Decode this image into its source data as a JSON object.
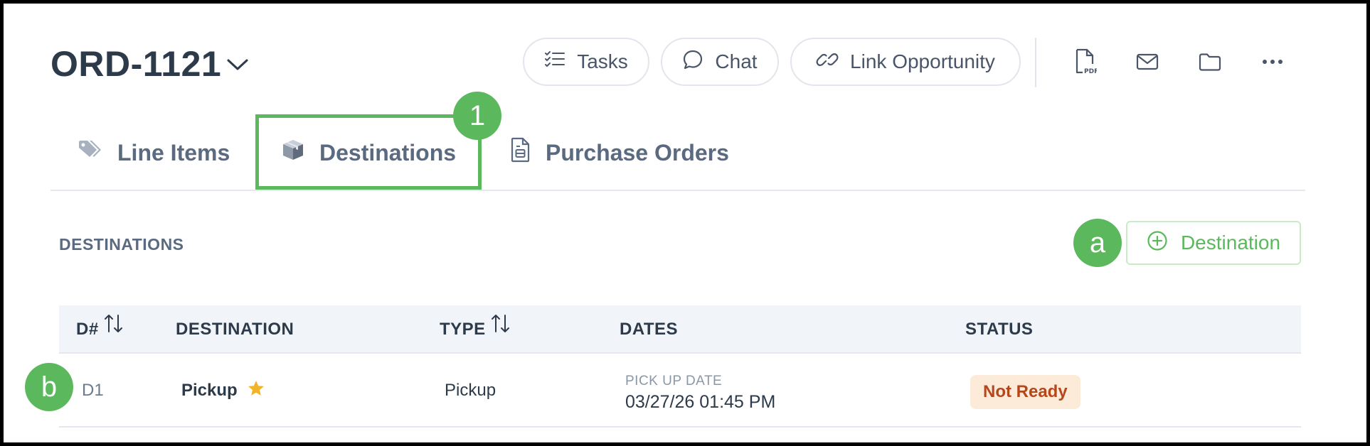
{
  "header": {
    "order_id": "ORD-1121",
    "buttons": {
      "tasks": "Tasks",
      "chat": "Chat",
      "link_opportunity": "Link Opportunity"
    },
    "icon_buttons": [
      "pdf-icon",
      "mail-icon",
      "folder-icon",
      "more-icon"
    ]
  },
  "tabs": [
    {
      "label": "Line Items",
      "icon": "tag-icon",
      "active": false
    },
    {
      "label": "Destinations",
      "icon": "box-icon",
      "active": true
    },
    {
      "label": "Purchase Orders",
      "icon": "document-icon",
      "active": false
    }
  ],
  "markers": {
    "tab": "1",
    "add_button": "a",
    "row": "b"
  },
  "section": {
    "title": "DESTINATIONS",
    "add_button_label": "Destination"
  },
  "table": {
    "columns": [
      "D#",
      "DESTINATION",
      "TYPE",
      "DATES",
      "STATUS"
    ],
    "rows": [
      {
        "id": "D1",
        "destination": "Pickup",
        "starred": true,
        "type": "Pickup",
        "date_label": "PICK UP DATE",
        "date_value": "03/27/26 01:45 PM",
        "status": "Not Ready"
      }
    ]
  },
  "colors": {
    "accent_green": "#5cb85c",
    "status_bg": "#fdebd9",
    "status_text": "#b5471c",
    "star": "#f0b429"
  }
}
